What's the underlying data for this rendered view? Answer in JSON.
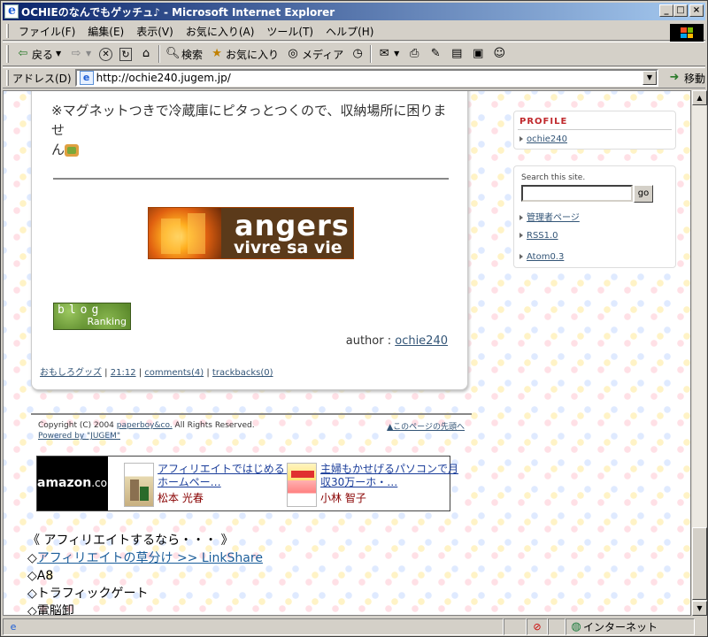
{
  "window": {
    "title": "OCHIEのなんでもゲッチュ♪ - Microsoft Internet Explorer"
  },
  "menu": [
    "ファイル(F)",
    "編集(E)",
    "表示(V)",
    "お気に入り(A)",
    "ツール(T)",
    "ヘルプ(H)"
  ],
  "toolbar": {
    "back_label": "戻る",
    "search_label": "検索",
    "favorites_label": "お気に入り",
    "media_label": "メディア"
  },
  "address": {
    "label": "アドレス(D)",
    "url": "http://ochie240.jugem.jp/",
    "go_label": "移動"
  },
  "entry": {
    "text": "※マグネットつきで冷蔵庫にピタっとつくので、収納場所に困りませ",
    "text_cont": "ん",
    "banner_line1": "angers",
    "banner_line2": "vivre sa vie",
    "blogrank_line1": "blog",
    "blogrank_line2": "Ranking",
    "author_label": "author : ",
    "author_name": "ochie240",
    "category": "おもしろグッズ",
    "time": "21:12",
    "comments": "comments(4)",
    "trackbacks": "trackbacks(0)"
  },
  "footer": {
    "copyright_prefix": "Copyright (C) 2004 ",
    "company": "paperboy&co.",
    "copyright_suffix": " All Rights Reserved.",
    "powered": "Powered by \"JUGEM\"",
    "to_top": "▲このページの先頭へ"
  },
  "amazon": {
    "logo": "amazon",
    "logo_suffix": ".co.jp",
    "items": [
      {
        "title": "アフィリエイトではじめる！ホームペー…",
        "author": "松本 光春"
      },
      {
        "title": "主婦もかせげるパソコンで月収30万ーホ・…",
        "author": "小林 智子"
      }
    ]
  },
  "affiliate": {
    "heading": "《 アフィリエイトするなら・・・ 》",
    "items": [
      {
        "prefix": "◇",
        "label": "アフィリエイトの草分け >> LinkShare",
        "link": true
      },
      {
        "prefix": "◇",
        "label": "A8",
        "link": false
      },
      {
        "prefix": "◇",
        "label": "トラフィックゲート",
        "link": false
      },
      {
        "prefix": "◇",
        "label": "電脳卸",
        "link": false
      }
    ]
  },
  "sidebar": {
    "profile_heading": "PROFILE",
    "profile_name": "ochie240",
    "search_caption": "Search this site.",
    "search_button": "go",
    "links": [
      "管理者ページ",
      "RSS1.0",
      "Atom0.3"
    ]
  },
  "status": {
    "zone": "インターネット"
  }
}
